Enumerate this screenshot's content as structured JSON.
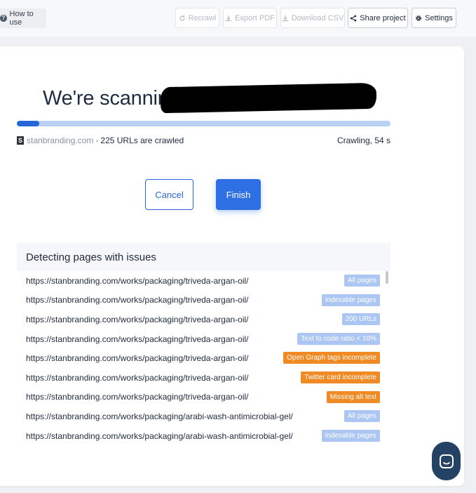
{
  "toolbar": {
    "how_to_use": "How to use",
    "recrawl": "Recrawl",
    "export_pdf": "Export PDF",
    "download_csv": "Download CSV",
    "share_project": "Share project",
    "settings": "Settings"
  },
  "scan": {
    "headline": "We're scanning",
    "progress_fraction": 0.06,
    "domain": "stanbranding.com",
    "separator": "·",
    "crawled_text": "225 URLs are crawled",
    "status": "Crawling, 54 s",
    "favicon_letter": "S"
  },
  "actions": {
    "cancel": "Cancel",
    "finish": "Finish"
  },
  "issues": {
    "title": "Detecting pages with issues",
    "rows": [
      {
        "url": "https://stanbranding.com/works/packaging/triveda-argan-oil/",
        "tag": "All pages",
        "tone": "blue"
      },
      {
        "url": "https://stanbranding.com/works/packaging/triveda-argan-oil/",
        "tag": "Indexable pages",
        "tone": "blue"
      },
      {
        "url": "https://stanbranding.com/works/packaging/triveda-argan-oil/",
        "tag": "200 URLs",
        "tone": "blue"
      },
      {
        "url": "https://stanbranding.com/works/packaging/triveda-argan-oil/",
        "tag": "Text to code ratio < 10%",
        "tone": "blue"
      },
      {
        "url": "https://stanbranding.com/works/packaging/triveda-argan-oil/",
        "tag": "Open Graph tags incomplete",
        "tone": "orange"
      },
      {
        "url": "https://stanbranding.com/works/packaging/triveda-argan-oil/",
        "tag": "Twitter card incomplete",
        "tone": "orange"
      },
      {
        "url": "https://stanbranding.com/works/packaging/triveda-argan-oil/",
        "tag": "Missing alt text",
        "tone": "orange"
      },
      {
        "url": "https://stanbranding.com/works/packaging/arabi-wash-antimicrobial-gel/",
        "tag": "All pages",
        "tone": "blue"
      },
      {
        "url": "https://stanbranding.com/works/packaging/arabi-wash-antimicrobial-gel/",
        "tag": "Indexable pages",
        "tone": "blue"
      }
    ]
  },
  "colors": {
    "accent": "#2766d9",
    "tag_blue": "#abc6f2",
    "tag_orange": "#f08a24",
    "chat_bg": "#244263"
  },
  "icons": {
    "how_to_use": "question-circle-icon",
    "recrawl": "refresh-icon",
    "export_pdf": "download-icon",
    "download_csv": "download-icon",
    "share_project": "share-icon",
    "settings": "gear-icon",
    "chat": "chat-icon"
  }
}
